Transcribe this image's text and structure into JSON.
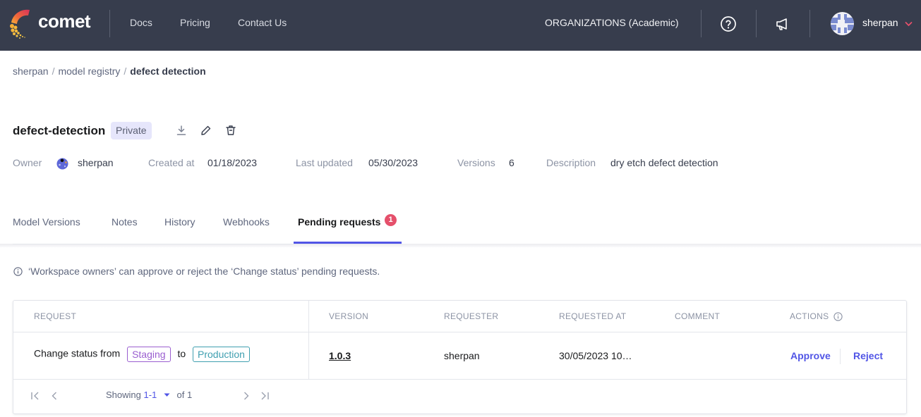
{
  "topnav": {
    "brand": "comet",
    "links": [
      "Docs",
      "Pricing",
      "Contact Us"
    ],
    "organization": "ORGANIZATIONS (Academic)",
    "help_icon": "question-circle-icon",
    "announcements_icon": "megaphone-icon",
    "username": "sherpan",
    "accent_color": "#e5506b"
  },
  "breadcrumb": [
    "sherpan",
    "model registry",
    "defect detection"
  ],
  "model": {
    "name": "defect-detection",
    "visibility": "Private",
    "actions": [
      "download-icon",
      "edit-icon",
      "delete-icon"
    ]
  },
  "meta": {
    "owner_label": "Owner",
    "owner_value": "sherpan",
    "created_label": "Created at",
    "created_value": "01/18/2023",
    "updated_label": "Last updated",
    "updated_value": "05/30/2023",
    "versions_label": "Versions",
    "versions_value": "6",
    "description_label": "Description",
    "description_value": "dry etch defect detection"
  },
  "tabs": [
    {
      "label": "Model Versions"
    },
    {
      "label": "Notes"
    },
    {
      "label": "History"
    },
    {
      "label": "Webhooks"
    },
    {
      "label": "Pending requests",
      "badge": "1",
      "active": true
    }
  ],
  "info_text": "‘Workspace owners’ can approve or reject the ‘Change status’ pending requests.",
  "table": {
    "columns": [
      "REQUEST",
      "VERSION",
      "REQUESTER",
      "REQUESTED AT",
      "COMMENT",
      "ACTIONS"
    ],
    "rows": [
      {
        "request_prefix": "Change status from",
        "from_stage": "Staging",
        "connector": "to",
        "to_stage": "Production",
        "version": "1.0.3",
        "requester": "sherpan",
        "requested_at": "30/05/2023 10…",
        "comment": "",
        "approve": "Approve",
        "reject": "Reject"
      }
    ],
    "pagination": {
      "showing_label": "Showing",
      "range": "1-1",
      "of_label": "of 1"
    }
  },
  "colors": {
    "nav_bg": "#373d4d",
    "primary": "#5155e6",
    "staging": "#9a5ed0",
    "production": "#3f9fb0",
    "badge": "#e5506b"
  }
}
